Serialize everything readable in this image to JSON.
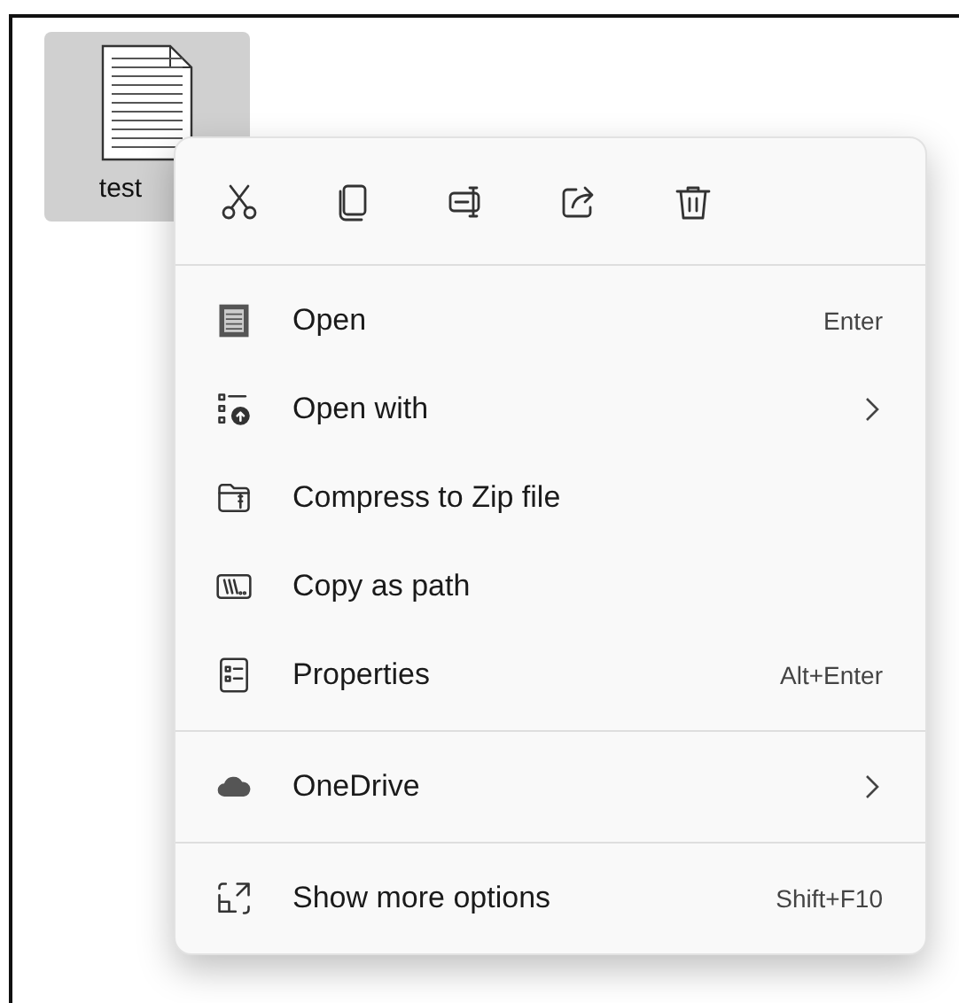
{
  "file": {
    "name": "test",
    "selected": true
  },
  "menu": {
    "sections": [
      {
        "items": [
          {
            "label": "Open",
            "shortcut": "Enter",
            "submenu": false
          },
          {
            "label": "Open with",
            "submenu": true
          },
          {
            "label": "Compress to Zip file",
            "submenu": false
          },
          {
            "label": "Copy as path",
            "submenu": false
          },
          {
            "label": "Properties",
            "shortcut": "Alt+Enter",
            "submenu": false
          }
        ]
      },
      {
        "items": [
          {
            "label": "OneDrive",
            "submenu": true
          }
        ]
      },
      {
        "items": [
          {
            "label": "Show more options",
            "shortcut": "Shift+F10",
            "submenu": false
          }
        ]
      }
    ]
  }
}
